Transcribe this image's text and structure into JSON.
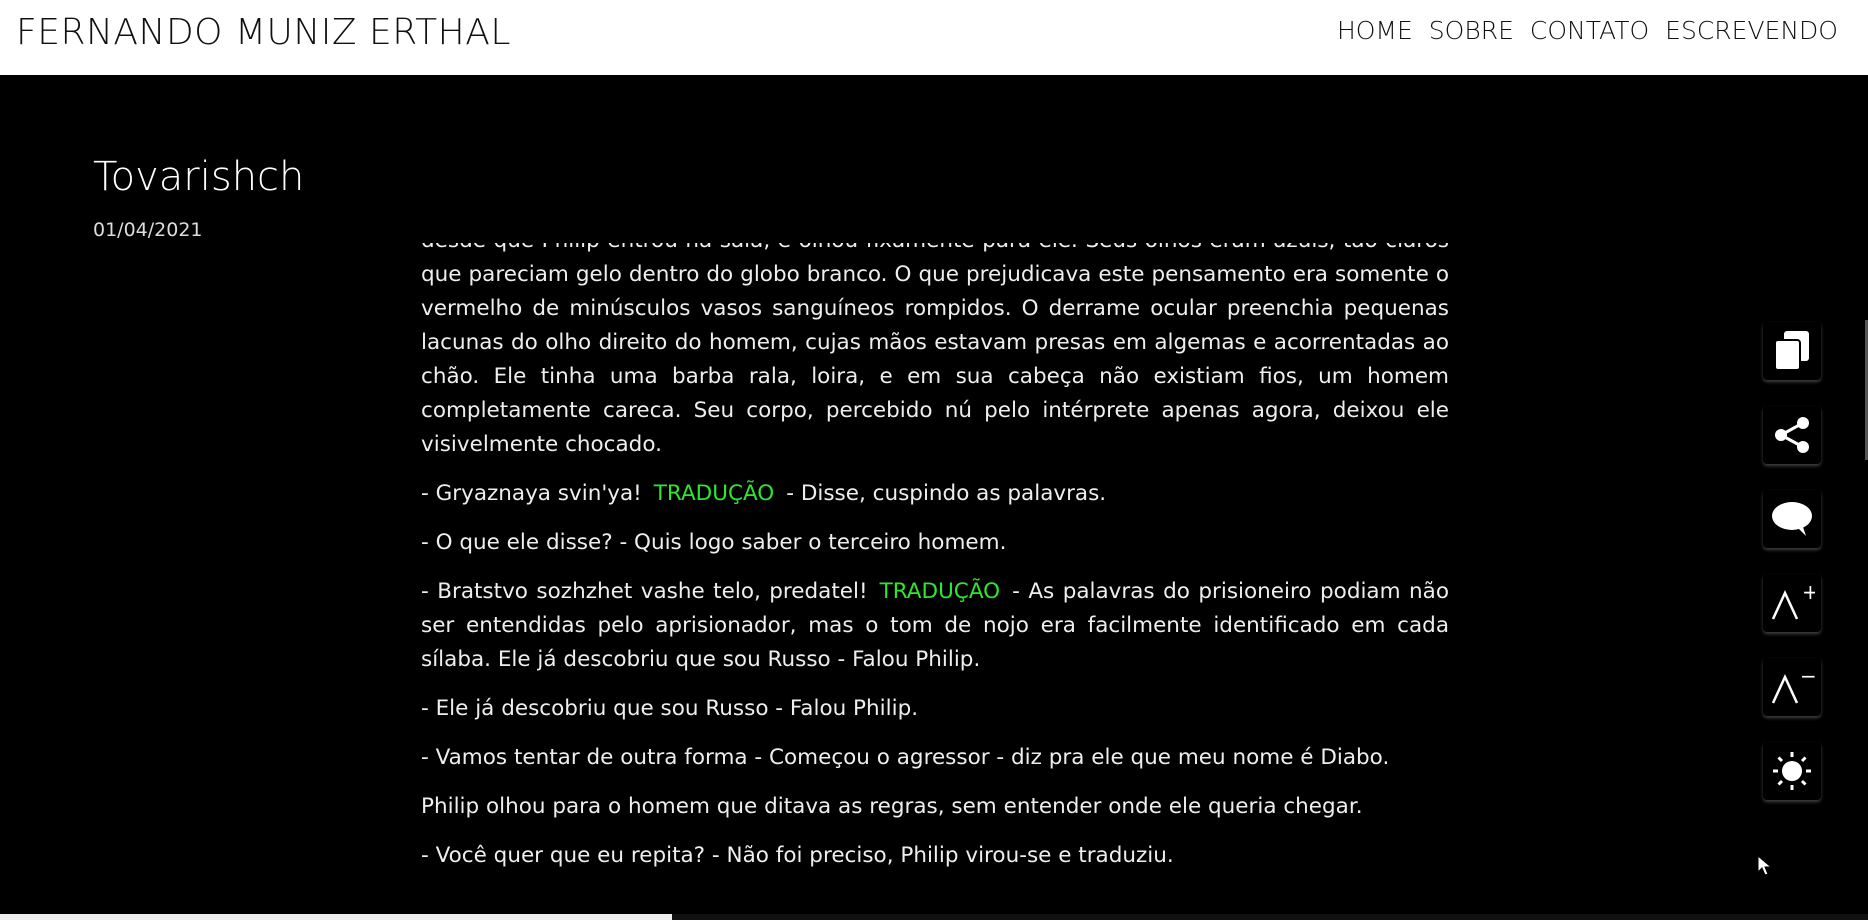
{
  "header": {
    "site_title": "FERNANDO MUNIZ ERTHAL",
    "nav": [
      "HOME",
      "SOBRE",
      "CONTATO",
      "ESCREVENDO"
    ]
  },
  "post": {
    "title": "Tovarishch",
    "date": "01/04/2021"
  },
  "article": {
    "p1": "desde que Philip entrou na sala, e olhou fixamente para ele. Seus olhos eram azuis, tão claros que pareciam gelo dentro do globo branco. O que prejudicava este pensamento era somente o vermelho de minúsculos vasos sanguíneos rompidos. O derrame ocular preenchia pequenas lacunas do olho direito do homem, cujas mãos estavam presas em algemas e acorrentadas ao chão. Ele tinha uma barba rala, loira, e em sua cabeça não existiam fios, um homem completamente careca. Seu corpo, percebido nú pelo intérprete apenas agora, deixou ele visivelmente chocado.",
    "p2_a": "- Gryaznaya svin'ya!",
    "p2_trad": "TRADUÇÃO",
    "p2_b": "- Disse, cuspindo as palavras.",
    "p3": "- O que ele disse? - Quis logo saber o terceiro homem.",
    "p4_a": "- Bratstvo sozhzhet vashe telo, predatel!",
    "p4_trad": "TRADUÇÃO",
    "p4_b": "- As palavras do prisioneiro podiam não ser entendidas pelo aprisionador, mas o tom de nojo era facilmente identificado em cada sílaba. Ele já descobriu que sou Russo - Falou Philip.",
    "p5": "- Ele já descobriu que sou Russo - Falou Philip.",
    "p6": "- Vamos tentar de outra forma - Começou o agressor - diz pra ele que meu nome é Diabo.",
    "p7": "Philip olhou para o homem que ditava as regras, sem entender onde ele queria chegar.",
    "p8": "- Você quer que eu repita? - Não foi preciso, Philip virou-se e traduziu."
  },
  "tools": {
    "icons": [
      "copy-icon",
      "share-icon",
      "comment-icon",
      "font-increase-icon",
      "font-decrease-icon",
      "brightness-icon"
    ],
    "font_increase_glyph": "A",
    "font_increase_sign": "+",
    "font_decrease_glyph": "A",
    "font_decrease_sign": "−"
  },
  "reading_progress": 0.36,
  "colors": {
    "background": "#000000",
    "header_bg": "#ffffff",
    "translation_link": "#2ee62e"
  }
}
